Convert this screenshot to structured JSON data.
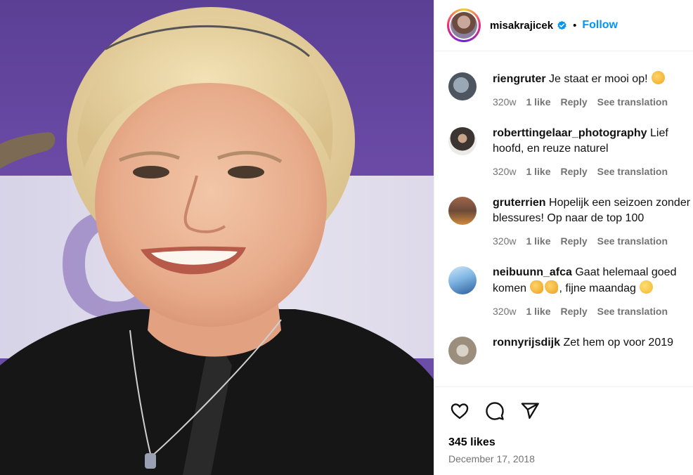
{
  "post": {
    "username": "misakrajicek",
    "follow_label": "Follow",
    "separator": "•",
    "likes": "345 likes",
    "date": "December 17, 2018"
  },
  "comments": [
    {
      "user": "riengruter",
      "text": "Je staat er mooi op!",
      "emoji": [
        "clapping-hands-emoji"
      ],
      "time": "320w",
      "likes": "1 like",
      "reply": "Reply",
      "translation": "See translation"
    },
    {
      "user": "roberttingelaar_photography",
      "text": "Lief hoofd, en reuze naturel",
      "time": "320w",
      "likes": "1 like",
      "reply": "Reply",
      "translation": "See translation"
    },
    {
      "user": "gruterrien",
      "text": "Hopelijk een seizoen zonder blessures! Op naar de top 100",
      "time": "320w",
      "likes": "1 like",
      "reply": "Reply",
      "translation": "See translation"
    },
    {
      "user": "neibuunn_afca",
      "text_a": "Gaat helemaal goed komen",
      "text_b": ", fijne maandag",
      "emoji": [
        "flexed-biceps-emoji",
        "flexed-biceps-emoji",
        "smiling-face-emoji"
      ],
      "time": "320w",
      "likes": "1 like",
      "reply": "Reply",
      "translation": "See translation"
    },
    {
      "user": "ronnyrijsdijk",
      "text": "Zet hem op voor 2019"
    }
  ],
  "photo": {
    "background_letters": "OR"
  },
  "icons": {
    "like": "heart-icon",
    "comment": "comment-icon",
    "share": "share-icon",
    "verified": "verified-badge-icon"
  },
  "colors": {
    "follow": "#0095f6",
    "meta": "#737373",
    "photo_purple": "#6a4aa5"
  }
}
